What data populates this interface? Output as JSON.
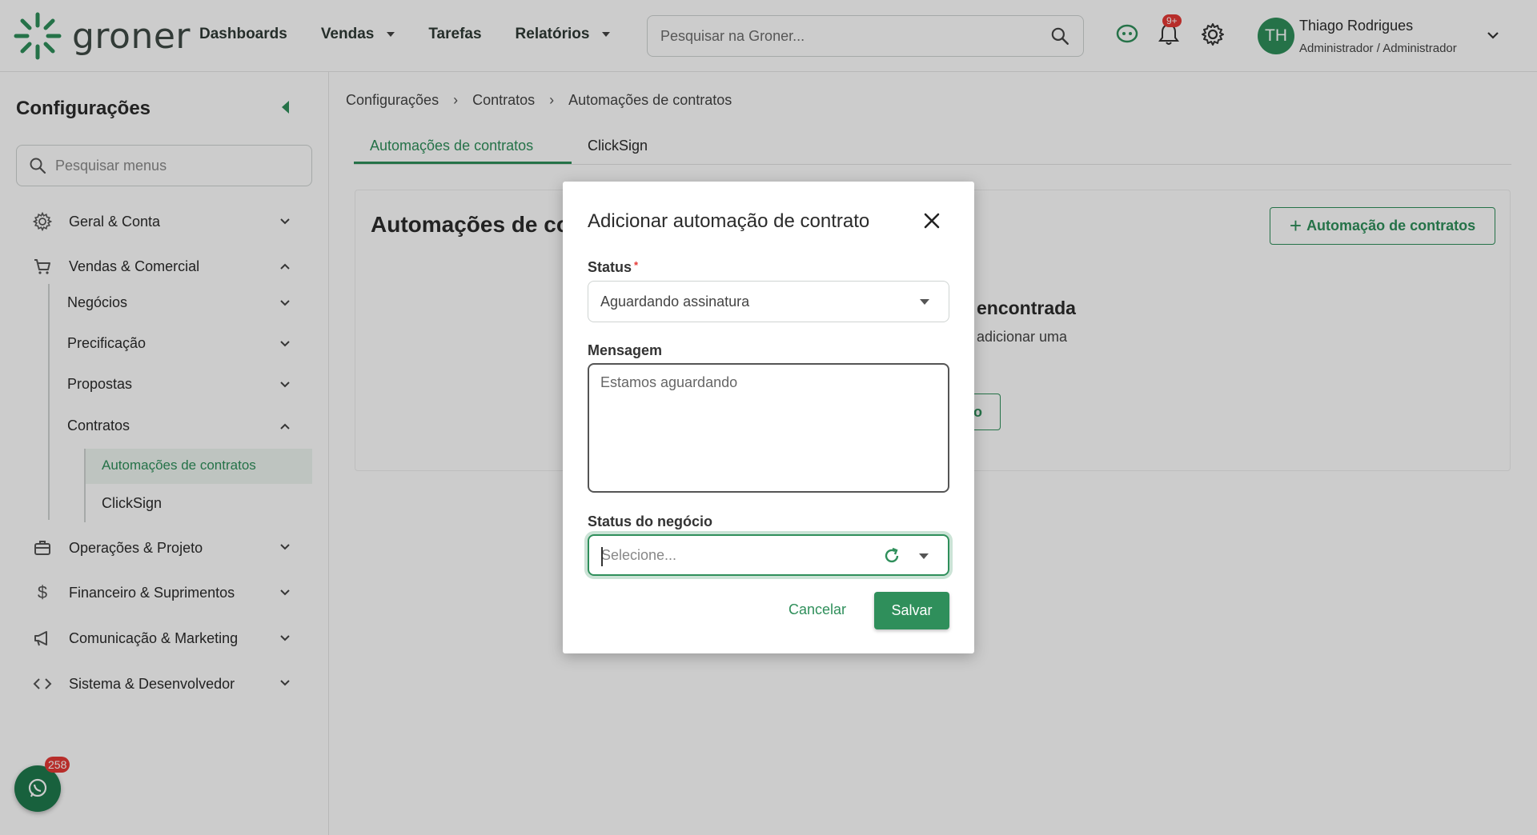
{
  "app": {
    "brand": "groner"
  },
  "header": {
    "nav": [
      {
        "label": "Dashboards",
        "has_dropdown": false
      },
      {
        "label": "Vendas",
        "has_dropdown": true
      },
      {
        "label": "Tarefas",
        "has_dropdown": false
      },
      {
        "label": "Relatórios",
        "has_dropdown": true
      }
    ],
    "search_placeholder": "Pesquisar na Groner...",
    "notifications_badge": "9+",
    "user": {
      "initials": "TH",
      "name": "Thiago Rodrigues",
      "role": "Administrador / Administrador"
    }
  },
  "sidebar": {
    "title": "Configurações",
    "search_placeholder": "Pesquisar menus",
    "items": [
      {
        "label": "Geral & Conta",
        "icon": "gear-icon"
      },
      {
        "label": "Vendas & Comercial",
        "icon": "cart-icon"
      },
      {
        "label": "Operações & Projeto",
        "icon": "briefcase-icon"
      },
      {
        "label": "Financeiro & Suprimentos",
        "icon": "dollar-icon"
      },
      {
        "label": "Comunicação & Marketing",
        "icon": "megaphone-icon"
      },
      {
        "label": "Sistema & Desenvolvedor",
        "icon": "code-icon"
      }
    ],
    "sub_items": [
      "Negócios",
      "Precificação",
      "Propostas",
      "Contratos"
    ],
    "sub_sub_items": [
      "Automações de contratos",
      "ClickSign"
    ],
    "whatsapp_badge": "258"
  },
  "main": {
    "breadcrumb": [
      "Configurações",
      "Contratos",
      "Automações de contratos"
    ],
    "tabs": [
      "Automações de contratos",
      "ClickSign"
    ],
    "card_title": "Automações de co",
    "add_button": "Automação de contratos",
    "empty_title": "encontrada",
    "empty_subtitle": "adicionar uma",
    "empty_button_fragment": "o"
  },
  "modal": {
    "title": "Adicionar automação de contrato",
    "status_label": "Status",
    "status_required_mark": "*",
    "status_value": "Aguardando assinatura",
    "message_label": "Mensagem",
    "message_value": "Estamos aguardando",
    "deal_status_label": "Status do negócio",
    "deal_status_placeholder": "Selecione...",
    "cancel_label": "Cancelar",
    "save_label": "Salvar"
  },
  "colors": {
    "accent": "#2f8f5b",
    "badge": "#e53935"
  }
}
